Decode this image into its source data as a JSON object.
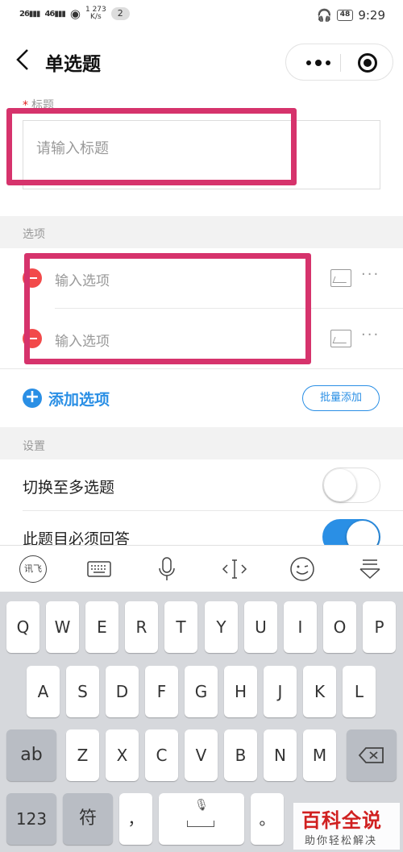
{
  "status_bar": {
    "signal_1": "26",
    "signal_2": "46",
    "net_speed_value": "273",
    "net_speed_unit": "K/s",
    "net_speed_prefix": "1",
    "notification_count": "2",
    "battery": "48",
    "time": "9:29"
  },
  "nav": {
    "title": "单选题"
  },
  "form": {
    "title_label": "标题",
    "title_placeholder": "请输入标题",
    "options_label": "选项",
    "options": [
      {
        "placeholder": "输入选项"
      },
      {
        "placeholder": "输入选项"
      }
    ],
    "add_option_label": "添加选项",
    "batch_add_label": "批量添加",
    "settings_label": "设置",
    "settings": [
      {
        "label": "切换至多选题",
        "on": false
      },
      {
        "label": "此题目必须回答",
        "on": true
      }
    ]
  },
  "keyboard": {
    "toolbar": {
      "ime_logo": "讯飞"
    },
    "row1": [
      "Q",
      "W",
      "E",
      "R",
      "T",
      "Y",
      "U",
      "I",
      "O",
      "P"
    ],
    "row2": [
      "A",
      "S",
      "D",
      "F",
      "G",
      "H",
      "J",
      "K",
      "L"
    ],
    "shift_label": "ab",
    "row3": [
      "Z",
      "X",
      "C",
      "V",
      "B",
      "N",
      "M"
    ],
    "num_label": "123",
    "symbol_label": "符",
    "comma": "，",
    "period": "。"
  },
  "watermark": {
    "title": "百科全说",
    "subtitle": "助你轻松解决"
  },
  "colors": {
    "accent": "#2a8fe5",
    "highlight": "#d6336c",
    "delete": "#f24a4a",
    "required": "#e02020"
  }
}
